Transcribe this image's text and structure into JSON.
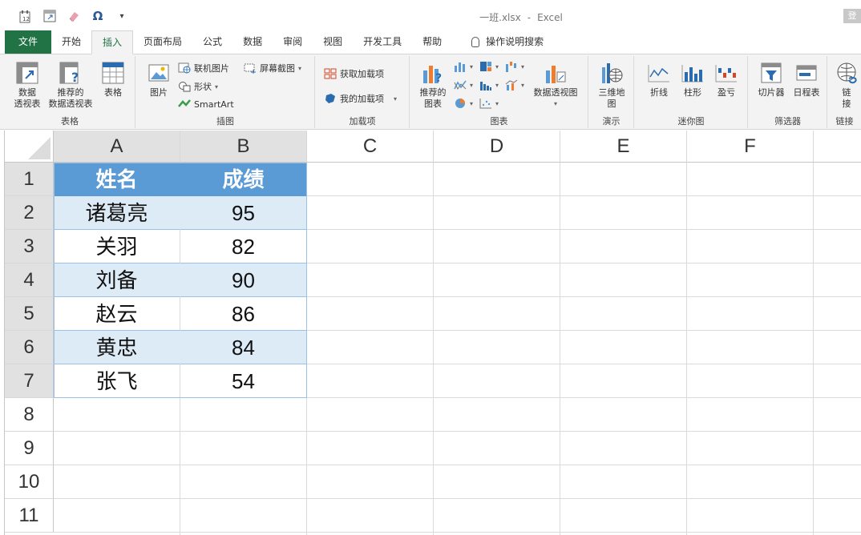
{
  "titlebar": {
    "filename": "一班.xlsx",
    "separator": "-",
    "app": "Excel",
    "signin": "登"
  },
  "qat": {
    "icons": [
      "calendar-icon",
      "pivot-icon",
      "eraser-icon",
      "omega-icon",
      "customize-icon"
    ],
    "omega": "Ω",
    "customize": "▾"
  },
  "tabs": [
    {
      "label": "文件"
    },
    {
      "label": "开始"
    },
    {
      "label": "插入"
    },
    {
      "label": "页面布局"
    },
    {
      "label": "公式"
    },
    {
      "label": "数据"
    },
    {
      "label": "审阅"
    },
    {
      "label": "视图"
    },
    {
      "label": "开发工具"
    },
    {
      "label": "帮助"
    }
  ],
  "tell_me": "操作说明搜索",
  "ribbon": {
    "tables": {
      "label": "表格",
      "pivot_l1": "数据",
      "pivot_l2": "透视表",
      "rec_pivot_l1": "推荐的",
      "rec_pivot_l2": "数据透视表",
      "table": "表格"
    },
    "illustrations": {
      "label": "插图",
      "picture": "图片",
      "online_pic": "联机图片",
      "shapes": "形状",
      "smartart": "SmartArt",
      "screenshot": "屏幕截图"
    },
    "addins": {
      "label": "加载项",
      "get": "获取加载项",
      "mine": "我的加载项"
    },
    "charts": {
      "label": "图表",
      "rec_l1": "推荐的",
      "rec_l2": "图表",
      "pivot_chart": "数据透视图"
    },
    "tours": {
      "label": "演示",
      "map_l1": "三维地",
      "map_l2": "图"
    },
    "sparklines": {
      "label": "迷你图",
      "line": "折线",
      "column": "柱形",
      "winloss": "盈亏"
    },
    "filters": {
      "label": "筛选器",
      "slicer": "切片器",
      "timeline": "日程表"
    },
    "links": {
      "label": "链接",
      "link_l1": "链",
      "link_l2": "接"
    }
  },
  "sheet": {
    "columns": [
      "A",
      "B",
      "C",
      "D",
      "E",
      "F"
    ],
    "rows": [
      "1",
      "2",
      "3",
      "4",
      "5",
      "6",
      "7",
      "8",
      "9",
      "10",
      "11"
    ],
    "header": [
      "姓名",
      "成绩"
    ],
    "data": [
      [
        "诸葛亮",
        "95"
      ],
      [
        "关羽",
        "82"
      ],
      [
        "刘备",
        "90"
      ],
      [
        "赵云",
        "86"
      ],
      [
        "黄忠",
        "84"
      ],
      [
        "张飞",
        "54"
      ]
    ]
  }
}
